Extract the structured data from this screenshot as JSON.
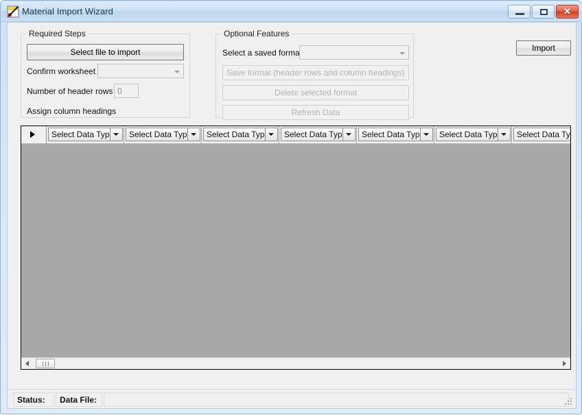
{
  "window": {
    "title": "Material Import Wizard",
    "icon": "spreadsheet-chart-icon",
    "controls": {
      "minimize": "minimize-icon",
      "maximize": "maximize-icon",
      "close": "✕"
    }
  },
  "required_steps": {
    "legend": "Required Steps",
    "select_file_button": "Select file to import",
    "confirm_worksheet_label": "Confirm worksheet",
    "confirm_worksheet_value": "",
    "header_rows_label": "Number of header rows",
    "header_rows_value": "0",
    "assign_headings_label": "Assign column headings"
  },
  "optional_features": {
    "legend": "Optional Features",
    "saved_format_label": "Select a saved format",
    "saved_format_value": "",
    "save_format_button": "Save format (header rows and column headings)",
    "delete_format_button": "Delete selected format",
    "refresh_data_button": "Refresh Data"
  },
  "actions": {
    "import_button": "Import"
  },
  "grid": {
    "row_selector_glyph": "row-select-arrow",
    "columns": [
      {
        "label": "Select Data Type"
      },
      {
        "label": "Select Data Type"
      },
      {
        "label": "Select Data Type"
      },
      {
        "label": "Select Data Type"
      },
      {
        "label": "Select Data Type"
      },
      {
        "label": "Select Data Type"
      },
      {
        "label": "Select Data Type"
      }
    ],
    "rows": []
  },
  "statusbar": {
    "status_label": "Status:",
    "datafile_label": "Data File:",
    "message": ""
  },
  "colors": {
    "aero_frame": "#cfe0f2",
    "client_bg": "#f0f0f0",
    "grid_body": "#a9a9a9",
    "close_button": "#cf3f26",
    "disabled_text": "#b4b4b4"
  }
}
